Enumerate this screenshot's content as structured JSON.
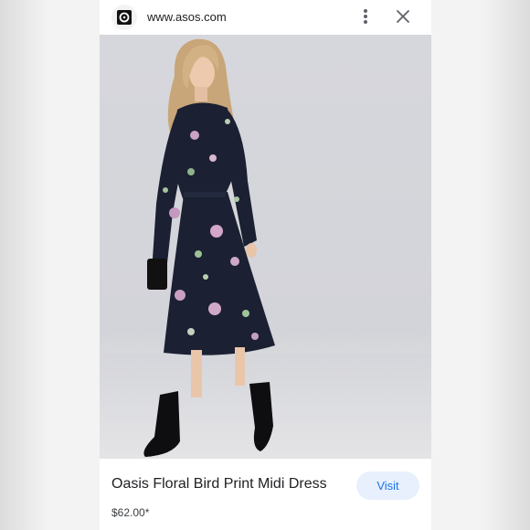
{
  "browser": {
    "url": "www.asos.com",
    "favicon_icon": "asos-logo-icon",
    "menu_icon": "more-vert-icon",
    "close_icon": "close-icon"
  },
  "product": {
    "title": "Oasis Floral Bird Print Midi Dress",
    "price": "$62.00*",
    "visit_label": "Visit"
  },
  "colors": {
    "accent": "#1a73e8",
    "visit_bg": "#e8f0fe",
    "dress": "#1b2032"
  }
}
